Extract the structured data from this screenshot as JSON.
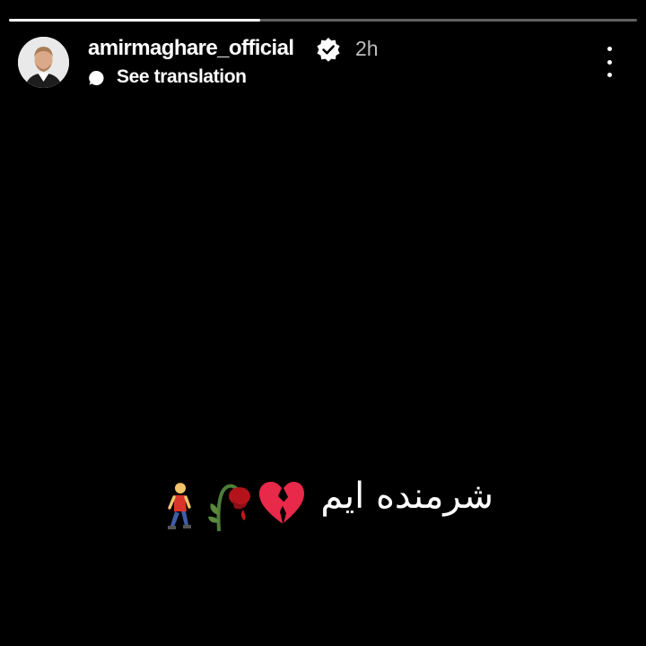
{
  "story": {
    "progress_fraction": 0.4,
    "username": "amirmaghare_official",
    "verified": true,
    "time_ago": "2h",
    "translate_label": "See translation",
    "icons": {
      "verified": "verified-badge-icon",
      "translate": "translate-icon",
      "more": "more-options-icon"
    },
    "caption": "شرمنده ایم",
    "caption_emojis": [
      "broken-heart-icon",
      "wilted-rose-icon",
      "walking-man-icon"
    ]
  },
  "colors": {
    "background": "#000000",
    "text": "#ffffff",
    "time": "#bdbdbd",
    "progress_track": "#616161",
    "verified_badge": "#ffffff",
    "heart": "#e8294a"
  }
}
